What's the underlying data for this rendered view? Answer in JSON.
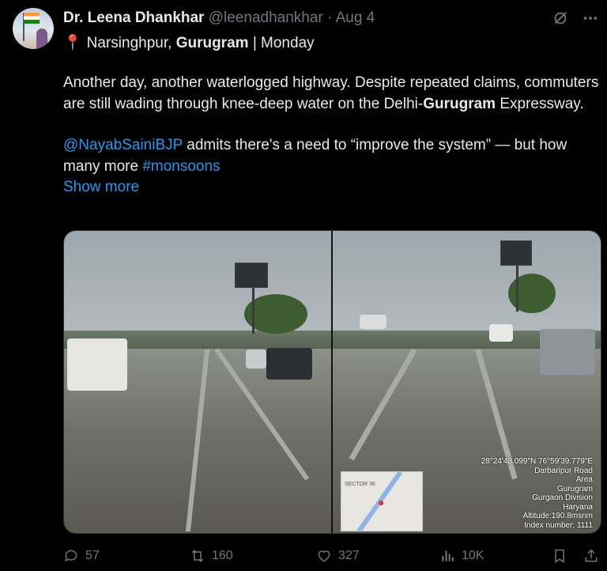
{
  "author": {
    "name": "Dr. Leena Dhankhar",
    "handle": "@leenadhankhar",
    "separator": "·",
    "date": "Aug 4"
  },
  "location_line": {
    "place": "Narsinghpur, ",
    "city": "Gurugram",
    "day": " | Monday"
  },
  "body": {
    "line1_part1": "Another day, another waterlogged highway. Despite repeated claims, commuters are still wading through knee-deep water on the Delhi-",
    "line1_bold": "Gurugram",
    "line1_part2": " Expressway.",
    "mention": "@NayabSainiBJP",
    "line2_mid": " admits there's a need to “improve the system” — but how many more ",
    "hashtag": "#monsoons",
    "show_more": "Show more"
  },
  "media": {
    "overlay": {
      "coords": "28°24'48.099\"N 76°59'39.779\"E",
      "road": "Darbaripur Road",
      "area": "Area",
      "city": "Gurugram",
      "division": "Gurgaon Division",
      "state": "Haryana",
      "altitude": "Altitude:190.8msnm",
      "index": "Index number: 1111"
    },
    "minimap_label": "SECTOR 36"
  },
  "actions": {
    "replies": "57",
    "reposts": "160",
    "likes": "327",
    "views": "10K"
  }
}
